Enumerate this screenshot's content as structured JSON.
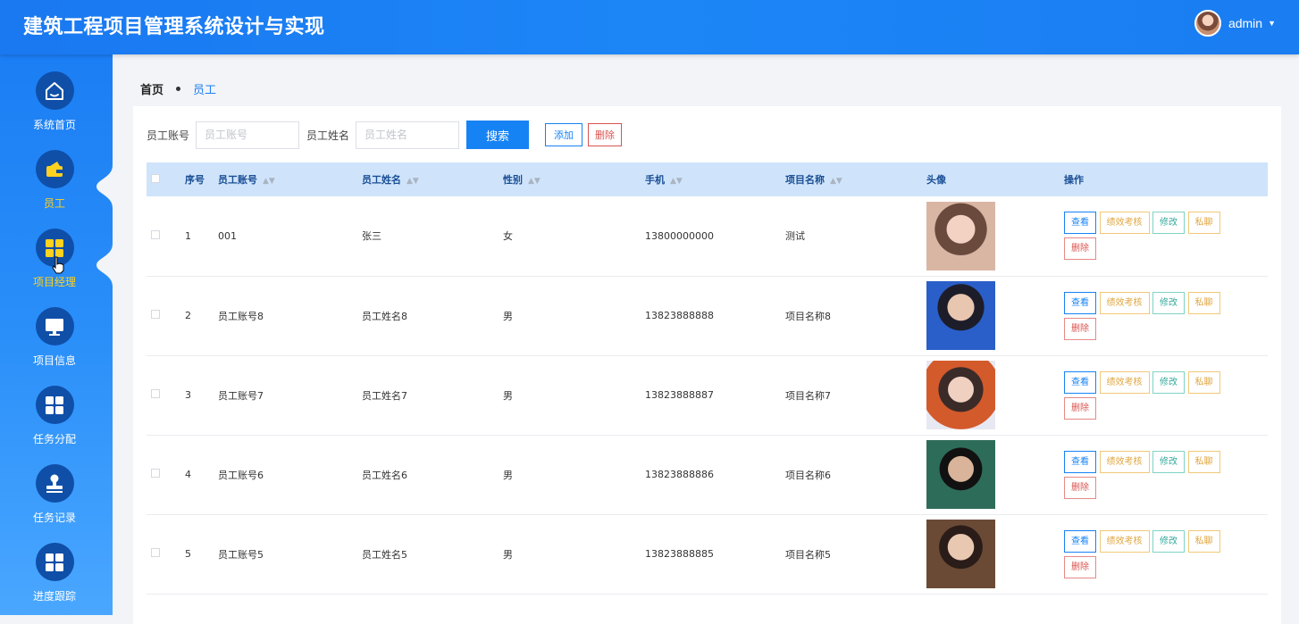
{
  "header": {
    "title": "建筑工程项目管理系统设计与实现",
    "user_name": "admin",
    "caret": "▼"
  },
  "sidebar": {
    "items": [
      {
        "label": "系统首页",
        "icon": "home-icon"
      },
      {
        "label": "员工",
        "icon": "wallet-icon"
      },
      {
        "label": "项目经理",
        "icon": "grid-icon"
      },
      {
        "label": "项目信息",
        "icon": "monitor-icon"
      },
      {
        "label": "任务分配",
        "icon": "grid-icon"
      },
      {
        "label": "任务记录",
        "icon": "stamp-icon"
      },
      {
        "label": "进度跟踪",
        "icon": "grid-icon"
      }
    ]
  },
  "breadcrumb": {
    "home": "首页",
    "current": "员工"
  },
  "search": {
    "account_label": "员工账号",
    "account_placeholder": "员工账号",
    "name_label": "员工姓名",
    "name_placeholder": "员工姓名",
    "search_button": "搜索",
    "add_button": "添加",
    "delete_button": "删除"
  },
  "table": {
    "headers": {
      "index": "序号",
      "account": "员工账号",
      "name": "员工姓名",
      "gender": "性别",
      "phone": "手机",
      "project": "项目名称",
      "avatar": "头像",
      "ops": "操作"
    },
    "op_labels": {
      "view": "查看",
      "perf": "绩效考核",
      "edit": "修改",
      "chat": "私聊",
      "delete": "删除"
    },
    "rows": [
      {
        "index": "1",
        "account": "001",
        "name": "张三",
        "gender": "女",
        "phone": "13800000000",
        "project": "测试"
      },
      {
        "index": "2",
        "account": "员工账号8",
        "name": "员工姓名8",
        "gender": "男",
        "phone": "13823888888",
        "project": "项目名称8"
      },
      {
        "index": "3",
        "account": "员工账号7",
        "name": "员工姓名7",
        "gender": "男",
        "phone": "13823888887",
        "project": "项目名称7"
      },
      {
        "index": "4",
        "account": "员工账号6",
        "name": "员工姓名6",
        "gender": "男",
        "phone": "13823888886",
        "project": "项目名称6"
      },
      {
        "index": "5",
        "account": "员工账号5",
        "name": "员工姓名5",
        "gender": "男",
        "phone": "13823888885",
        "project": "项目名称5"
      }
    ]
  },
  "colors": {
    "primary": "#1683f5",
    "header_bg": "#1a78f0",
    "sidebar_circle": "#0f4fa8",
    "table_head_bg": "#cfe4fb",
    "danger": "#d9534f",
    "warning": "#e0a640",
    "success": "#34a99a"
  }
}
